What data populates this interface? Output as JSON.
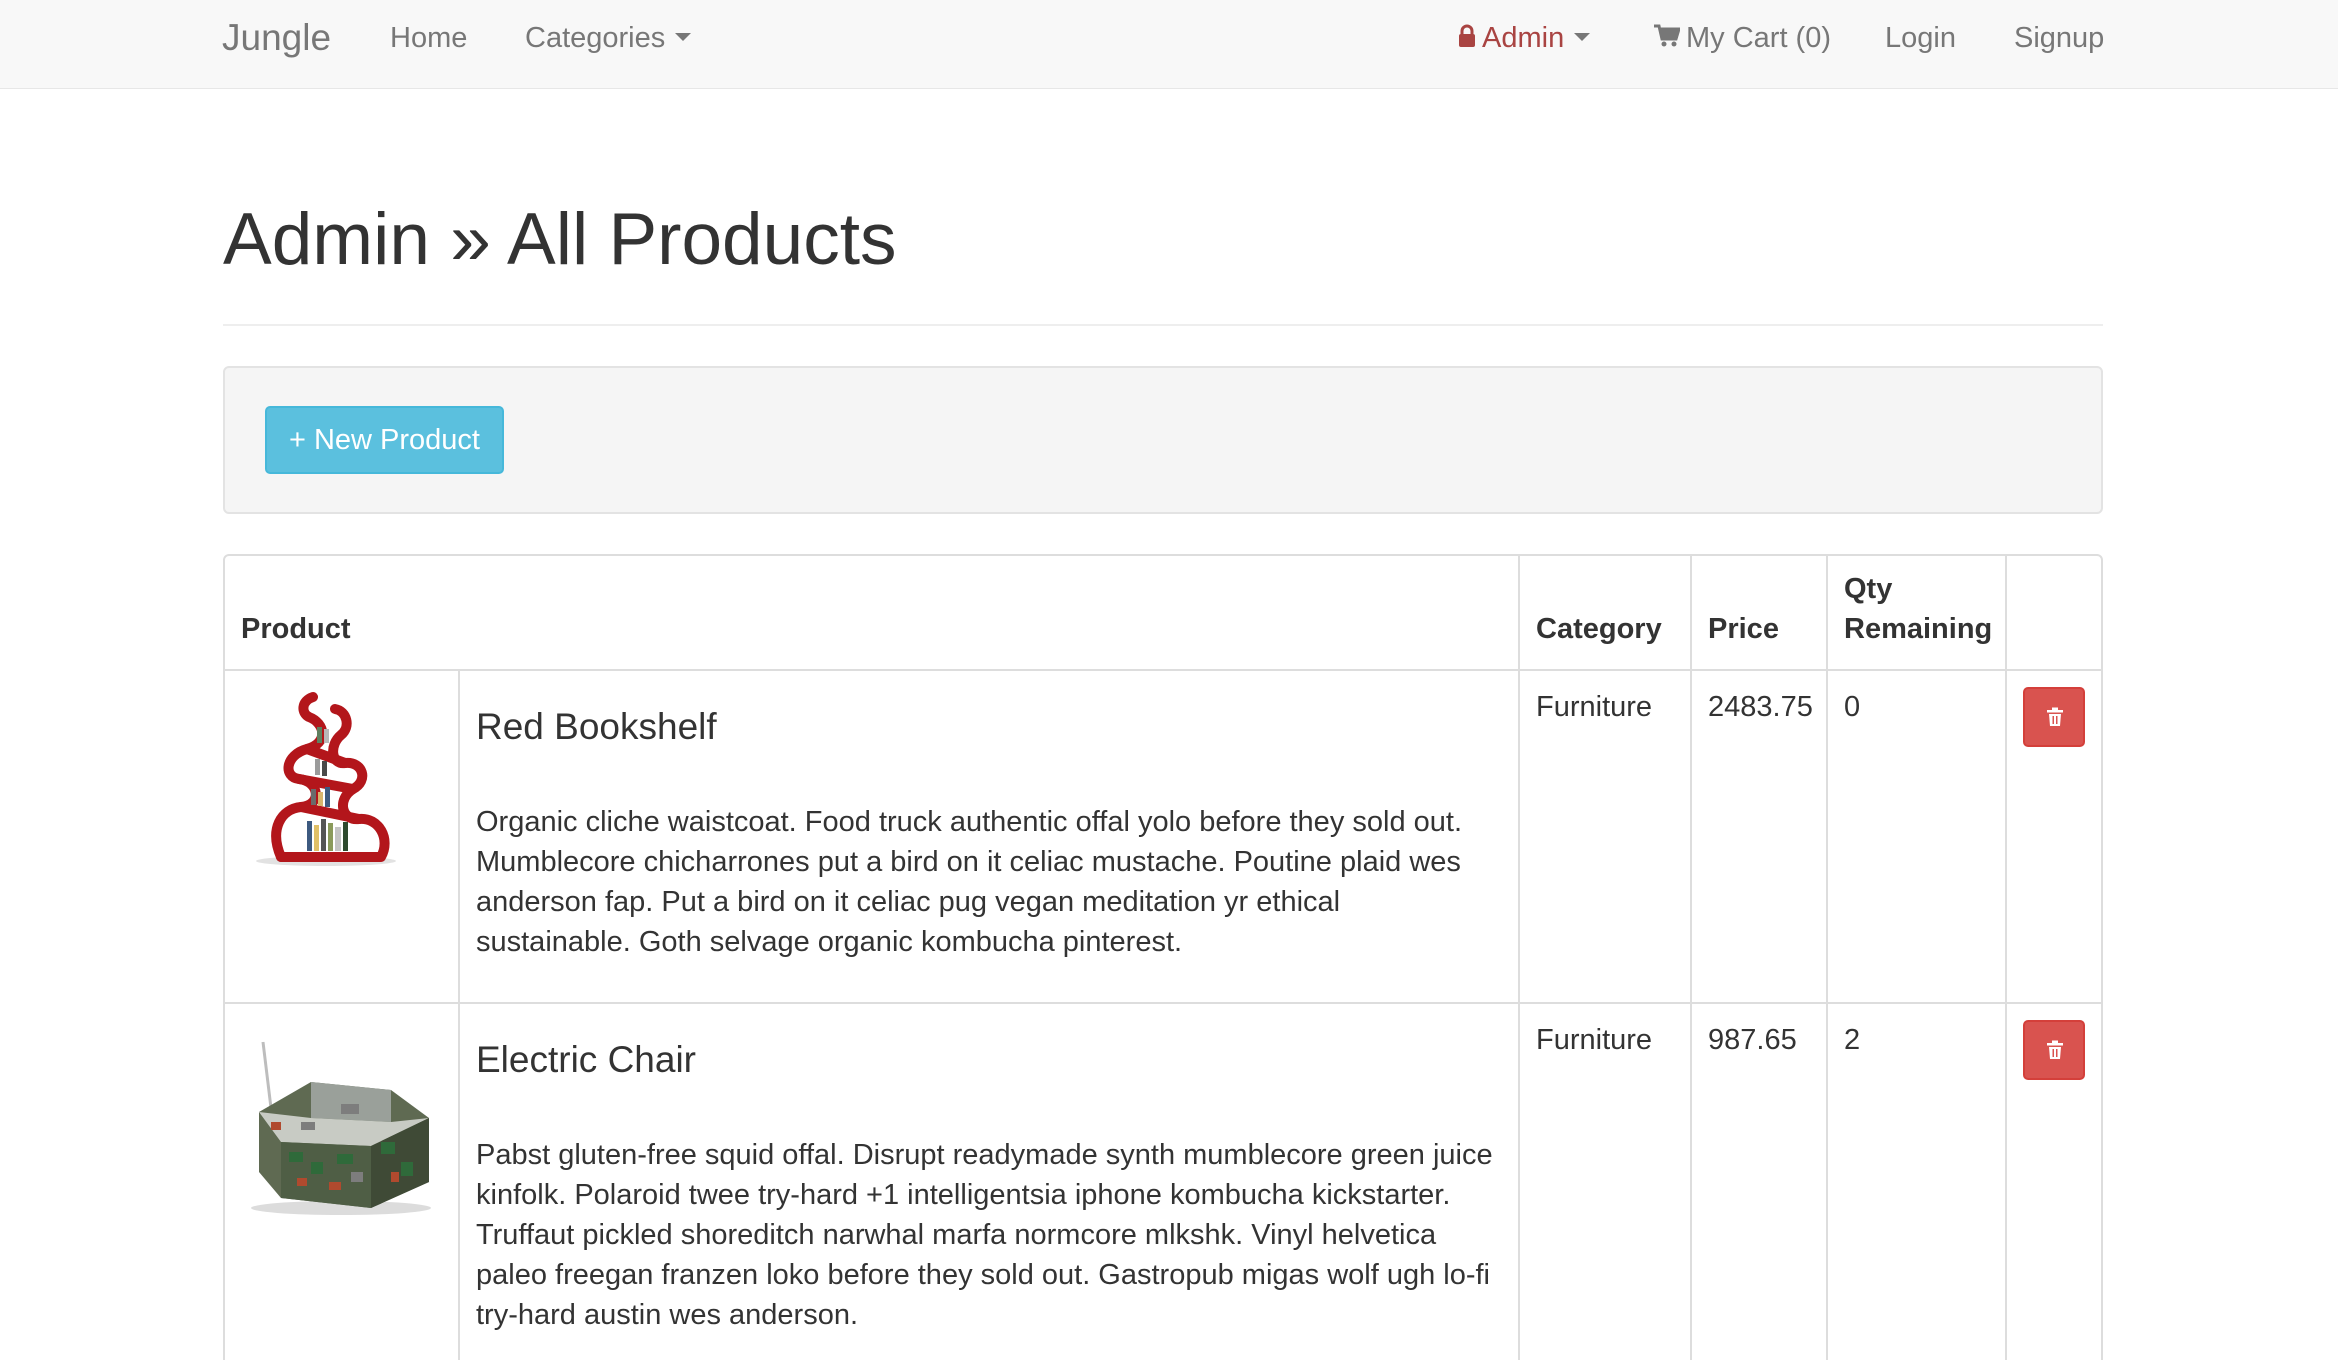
{
  "navbar": {
    "brand": "Jungle",
    "home": "Home",
    "categories": "Categories",
    "admin": "Admin",
    "cart": "My Cart (0)",
    "login": "Login",
    "signup": "Signup"
  },
  "page": {
    "title": "Admin » All Products"
  },
  "actions": {
    "new_product": "+ New Product"
  },
  "table": {
    "headers": {
      "product": "Product",
      "category": "Category",
      "price": "Price",
      "qty_line1": "Qty",
      "qty_line2": "Remaining"
    },
    "rows": [
      {
        "name": "Red Bookshelf",
        "description": "Organic cliche waistcoat. Food truck authentic offal yolo before they sold out. Mumblecore chicharrones put a bird on it celiac mustache. Poutine plaid wes anderson fap. Put a bird on it celiac pug vegan meditation yr ethical sustainable. Goth selvage organic kombucha pinterest.",
        "category": "Furniture",
        "price": "2483.75",
        "qty": "0"
      },
      {
        "name": "Electric Chair",
        "description": "Pabst gluten-free squid offal. Disrupt readymade synth mumblecore green juice kinfolk. Polaroid twee try-hard +1 intelligentsia iphone kombucha kickstarter. Truffaut pickled shoreditch narwhal marfa normcore mlkshk. Vinyl helvetica paleo freegan franzen loko before they sold out. Gastropub migas wolf ugh lo-fi try-hard austin wes anderson.",
        "category": "Furniture",
        "price": "987.65",
        "qty": "2"
      }
    ]
  },
  "colors": {
    "navbar_bg": "#f8f8f8",
    "admin_red": "#a94442",
    "info_button": "#5bc0de",
    "danger_button": "#d9534f"
  }
}
